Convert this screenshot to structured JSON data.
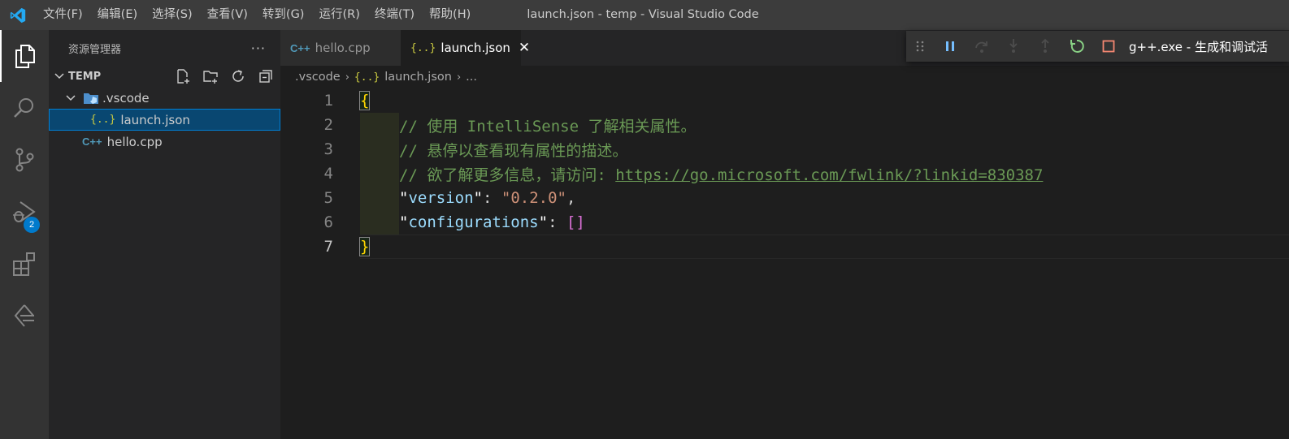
{
  "menu": [
    "文件(F)",
    "编辑(E)",
    "选择(S)",
    "查看(V)",
    "转到(G)",
    "运行(R)",
    "终端(T)",
    "帮助(H)"
  ],
  "window_title": "launch.json - temp - Visual Studio Code",
  "activity": {
    "debug_badge": "2"
  },
  "sidebar": {
    "title": "资源管理器",
    "more": "···",
    "section_label": "TEMP",
    "tree": {
      "folder": ".vscode",
      "file_json": "launch.json",
      "file_cpp": "hello.cpp",
      "json_glyph": "{..}",
      "cpp_glyph": "C++"
    }
  },
  "tabs": [
    {
      "glyph": "C++",
      "label": "hello.cpp"
    },
    {
      "glyph": "{..}",
      "label": "launch.json",
      "close": "✕"
    }
  ],
  "debug_toolbar": {
    "config": "g++.exe - 生成和调试活"
  },
  "breadcrumb": {
    "folder": ".vscode",
    "json_glyph": "{..}",
    "file": "launch.json",
    "more": "...",
    "sep": "›"
  },
  "code": {
    "line_numbers": [
      "1",
      "2",
      "3",
      "4",
      "5",
      "6",
      "7"
    ],
    "open_brace": "{",
    "comment1": "// 使用 IntelliSense 了解相关属性。",
    "comment2": "// 悬停以查看现有属性的描述。",
    "comment3_prefix": "// 欲了解更多信息，请访问: ",
    "comment3_link": "https://go.microsoft.com/fwlink/?linkid=830387",
    "version_key": "version",
    "version_value": "\"0.2.0\"",
    "configurations_key": "configurations",
    "empty_array": "[]",
    "close_brace": "}"
  },
  "colors": {
    "accent": "#007acc",
    "selection": "#094771",
    "comment": "#6a9955",
    "string": "#ce9178",
    "key": "#9cdcfe"
  }
}
